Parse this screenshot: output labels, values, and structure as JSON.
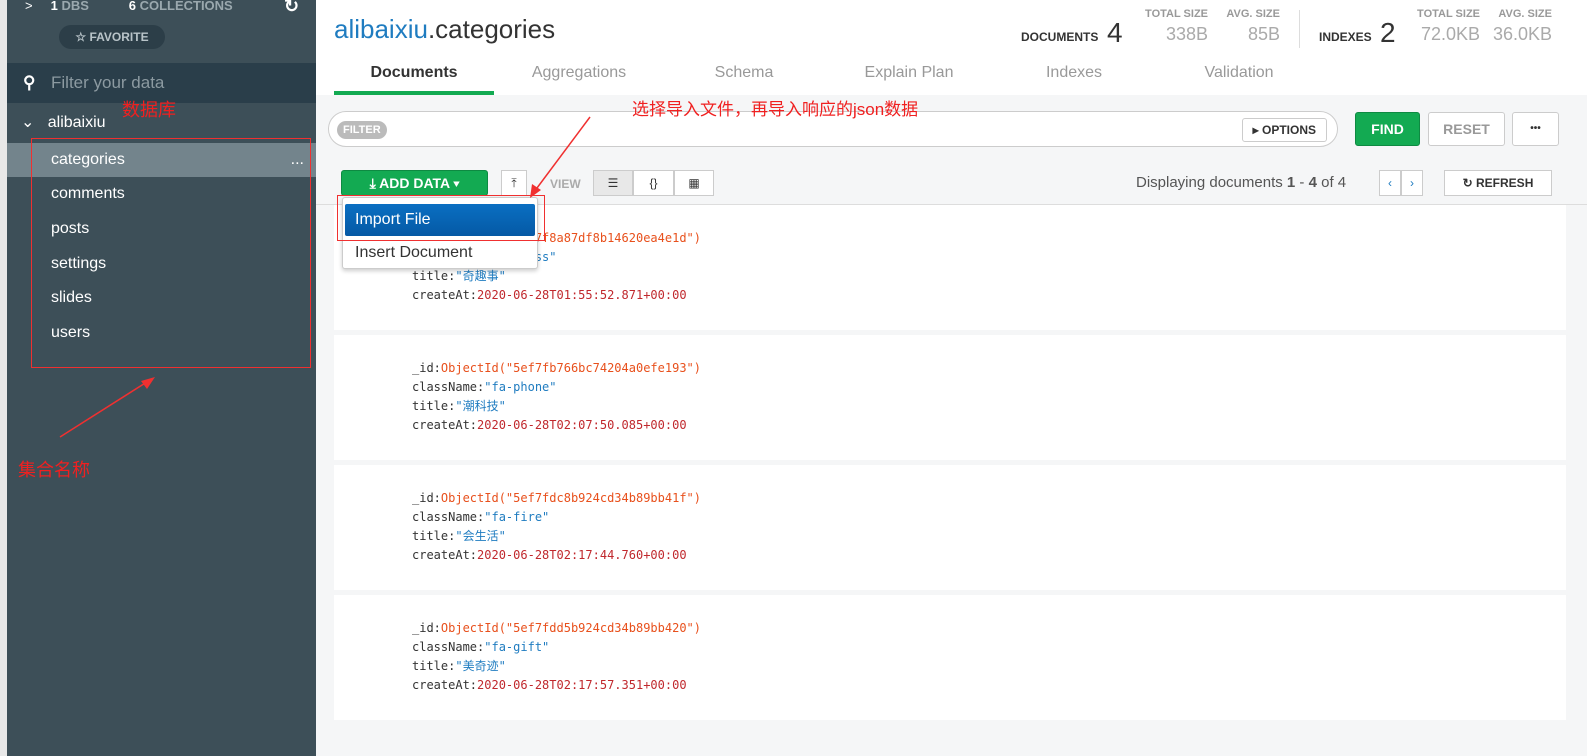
{
  "sidebar": {
    "dbs_count": "1",
    "dbs_label": "DBS",
    "collections_count": "6",
    "collections_label": "COLLECTIONS",
    "favorite": "☆ FAVORITE",
    "filter_placeholder": "Filter your data",
    "database": "alibaixiu",
    "collections": [
      "categories",
      "comments",
      "posts",
      "settings",
      "slides",
      "users"
    ],
    "more": "..."
  },
  "annotations": {
    "database": "数据库",
    "collections": "集合名称",
    "import": "选择导入文件，再导入响应的json数据",
    "color": "#f02020"
  },
  "header": {
    "db": "alibaixiu",
    "coll": ".categories",
    "documents_label": "DOCUMENTS",
    "documents": "4",
    "total_size_label": "TOTAL SIZE",
    "avg_size_label": "AVG. SIZE",
    "doc_total_size": "338B",
    "doc_avg_size": "85B",
    "indexes_label": "INDEXES",
    "indexes": "2",
    "idx_total_size": "72.0KB",
    "idx_avg_size": "36.0KB"
  },
  "tabs": [
    "Documents",
    "Aggregations",
    "Schema",
    "Explain Plan",
    "Indexes",
    "Validation"
  ],
  "query": {
    "filter_badge": "FILTER",
    "options": "▸ OPTIONS",
    "find": "FIND",
    "reset": "RESET",
    "more": "•••"
  },
  "toolbar": {
    "add_data": "ADD DATA ▾",
    "view_label": "VIEW",
    "displaying_pre": "Displaying documents ",
    "range_start": "1",
    "dash": " - ",
    "range_end": "4",
    "of": " of 4",
    "refresh": "↻ REFRESH"
  },
  "menu": {
    "import": "Import File",
    "insert": "Insert Document"
  },
  "documents": [
    {
      "id": "ObjectId(\"5ef7f8a87df8b14620ea4e1d\")",
      "className": "\"fa-glass\"",
      "title": "\"奇趣事\"",
      "createAt": "2020-06-28T01:55:52.871+00:00"
    },
    {
      "id": "ObjectId(\"5ef7fb766bc74204a0efe193\")",
      "className": "\"fa-phone\"",
      "title": "\"潮科技\"",
      "createAt": "2020-06-28T02:07:50.085+00:00"
    },
    {
      "id": "ObjectId(\"5ef7fdc8b924cd34b89bb41f\")",
      "className": "\"fa-fire\"",
      "title": "\"会生活\"",
      "createAt": "2020-06-28T02:17:44.760+00:00"
    },
    {
      "id": "ObjectId(\"5ef7fdd5b924cd34b89bb420\")",
      "className": "\"fa-gift\"",
      "title": "\"美奇迹\"",
      "createAt": "2020-06-28T02:17:57.351+00:00"
    }
  ],
  "field_labels": {
    "id": "_id:",
    "className": "className:",
    "title": "title:",
    "createAt": "createAt:"
  }
}
